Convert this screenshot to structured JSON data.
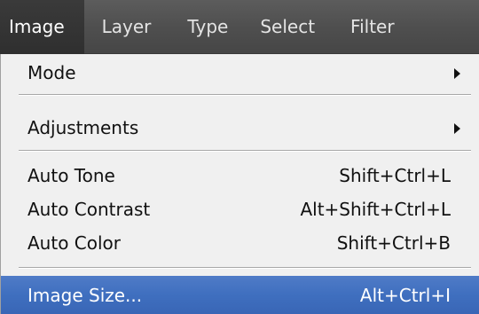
{
  "menubar": {
    "items": [
      {
        "label": "Image",
        "active": true
      },
      {
        "label": "Layer"
      },
      {
        "label": "Type"
      },
      {
        "label": "Select"
      },
      {
        "label": "Filter"
      }
    ]
  },
  "menu": {
    "mode": {
      "label": "Mode",
      "has_submenu": true
    },
    "adjustments": {
      "label": "Adjustments",
      "has_submenu": true
    },
    "auto_tone": {
      "label": "Auto Tone",
      "shortcut": "Shift+Ctrl+L"
    },
    "auto_contrast": {
      "label": "Auto Contrast",
      "shortcut": "Alt+Shift+Ctrl+L"
    },
    "auto_color": {
      "label": "Auto Color",
      "shortcut": "Shift+Ctrl+B"
    },
    "image_size": {
      "label": "Image Size...",
      "shortcut": "Alt+Ctrl+I",
      "highlighted": true
    }
  },
  "colors": {
    "menubar_bg": "#505050",
    "menubar_text": "#e4e4e4",
    "menu_bg": "#f0f0f0",
    "highlight": "#4272c2"
  }
}
